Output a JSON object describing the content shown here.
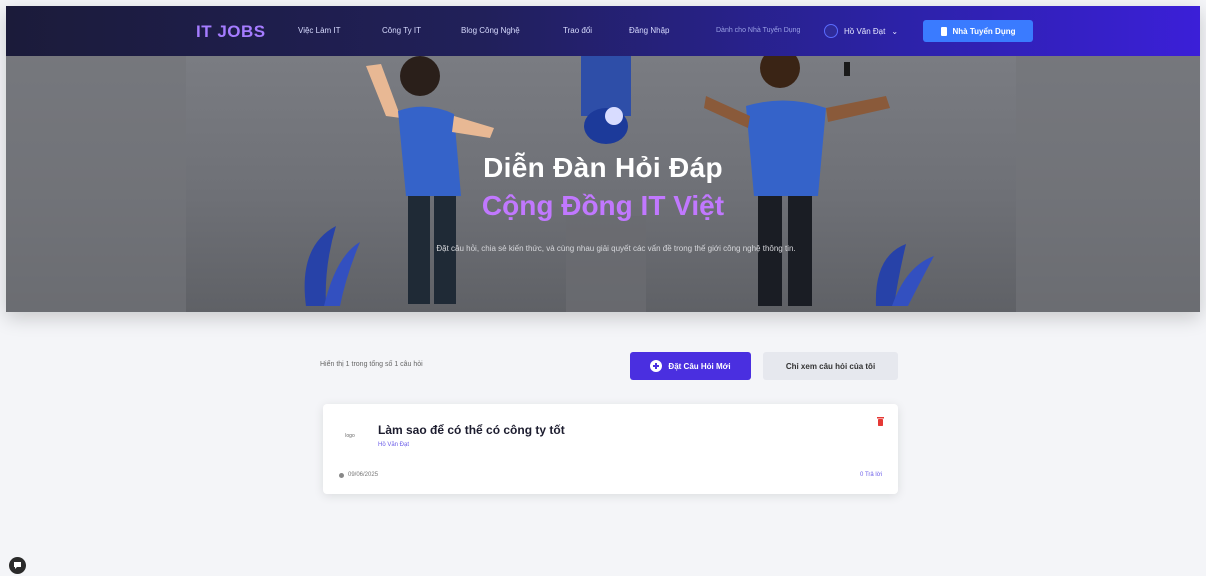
{
  "nav": {
    "brand": "IT JOBS",
    "links": [
      "Việc Làm IT",
      "Công Ty IT",
      "Blog Công Nghệ",
      "Trao đổi",
      "Đăng Nhập"
    ],
    "small_link": "Dành cho Nhà Tuyển Dụng",
    "user_label": "Hồ Văn Đạt",
    "post_job_label": "Nhà Tuyển Dụng"
  },
  "hero": {
    "title": "Diễn Đàn Hỏi Đáp",
    "subtitle": "Cộng Đồng IT Việt",
    "description": "Đặt câu hỏi, chia sẻ kiến thức, và cùng nhau giải quyết các vấn đề trong thế giới công nghệ thông tin."
  },
  "toolbar": {
    "caption": "Hiển thị 1 trong tổng số 1 câu hỏi",
    "ask_label": "Đặt Câu Hỏi Mới",
    "mine_label": "Chỉ xem câu hỏi của tôi"
  },
  "questions": [
    {
      "avatar_text": "logo",
      "title": "Làm sao để có thể có công ty tốt",
      "author": "Hồ Văn Đạt",
      "date": "09/06/2025",
      "answers": "0 Trả lời"
    }
  ],
  "colors": {
    "brand": "#a57cff",
    "accent": "#4a2fe0",
    "subtitle": "#c178ff",
    "nav_cta": "#3a7bff",
    "danger": "#e53935"
  },
  "icons": {
    "ask": "plus-circle-icon",
    "delete": "trash-icon",
    "date": "clock-icon",
    "chat": "chat-bubble-icon"
  }
}
